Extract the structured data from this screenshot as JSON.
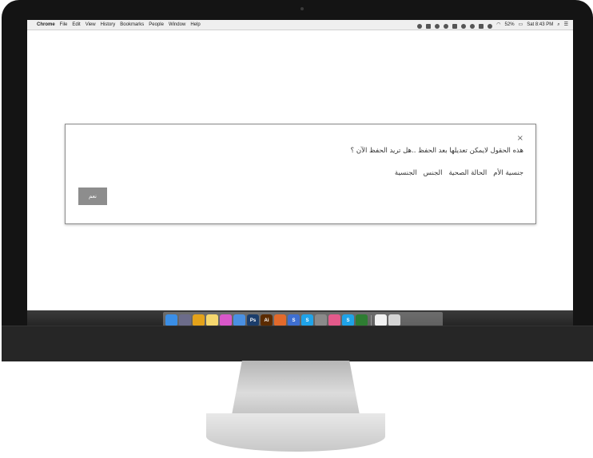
{
  "menubar": {
    "apple": "",
    "app": "Chrome",
    "items": [
      "File",
      "Edit",
      "View",
      "History",
      "Bookmarks",
      "People",
      "Window",
      "Help"
    ],
    "battery": "52%",
    "clock": "Sat 8:43 PM"
  },
  "modal": {
    "close": "×",
    "message": "هذه الحقول لايمكن تعديلها بعد الحفظ ..هل تريد الحفظ الآن ؟",
    "fields": [
      "الجنسية",
      "الجنس",
      "الحالة الصحية",
      "جنسية الأم"
    ],
    "confirm_label": "نعم"
  },
  "dock": {
    "apps": [
      {
        "icon": "finder-icon",
        "color": "#3a8ee6",
        "glyph": ""
      },
      {
        "icon": "launchpad-icon",
        "color": "#6c6c8a",
        "glyph": ""
      },
      {
        "icon": "chrome-icon",
        "color": "#e3a21a",
        "glyph": ""
      },
      {
        "icon": "notes-icon",
        "color": "#f5d76e",
        "glyph": ""
      },
      {
        "icon": "itunes-icon",
        "color": "#d957c9",
        "glyph": ""
      },
      {
        "icon": "messages-icon",
        "color": "#4a90e2",
        "glyph": ""
      },
      {
        "icon": "photoshop-icon",
        "color": "#1b3d6b",
        "glyph": "Ps"
      },
      {
        "icon": "illustrator-icon",
        "color": "#5b2b00",
        "glyph": "Ai"
      },
      {
        "icon": "git-icon",
        "color": "#e26a2c",
        "glyph": ""
      },
      {
        "icon": "sublime-icon",
        "color": "#3e6fd1",
        "glyph": "S"
      },
      {
        "icon": "skype-icon",
        "color": "#1fa3e8",
        "glyph": "S"
      },
      {
        "icon": "settings-icon",
        "color": "#8a8a8a",
        "glyph": ""
      },
      {
        "icon": "photos-icon",
        "color": "#e35a8b",
        "glyph": ""
      },
      {
        "icon": "skype-icon-2",
        "color": "#1fa3e8",
        "glyph": "S"
      },
      {
        "icon": "activity-monitor-icon",
        "color": "#2e7d32",
        "glyph": ""
      },
      {
        "icon": "documents-icon",
        "color": "#f2f2f2",
        "glyph": ""
      },
      {
        "icon": "trash-icon",
        "color": "#d4d4d4",
        "glyph": ""
      }
    ]
  }
}
